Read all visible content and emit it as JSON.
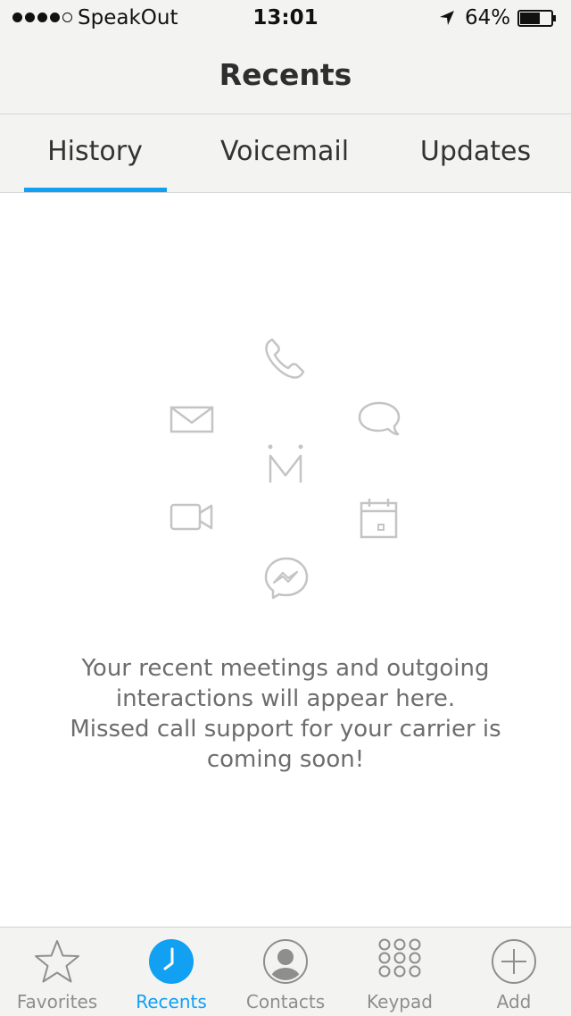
{
  "status_bar": {
    "carrier": "SpeakOut",
    "time": "13:01",
    "battery_percent": "64%",
    "signal_strength": 4,
    "signal_max": 5,
    "battery_level": 0.64
  },
  "header": {
    "title": "Recents"
  },
  "tabs": [
    {
      "label": "History",
      "active": true
    },
    {
      "label": "Voicemail",
      "active": false
    },
    {
      "label": "Updates",
      "active": false
    }
  ],
  "empty_state": {
    "icons": [
      "phone-icon",
      "email-icon",
      "chat-bubble-icon",
      "app-logo-m-icon",
      "video-icon",
      "calendar-icon",
      "messenger-icon"
    ],
    "message_lines": [
      "Your recent meetings and outgoing",
      "interactions will appear here.",
      "Missed call support for your carrier is",
      "coming soon!"
    ]
  },
  "bottom_nav": {
    "items": [
      {
        "label": "Favorites",
        "icon": "star-icon",
        "active": false
      },
      {
        "label": "Recents",
        "icon": "clock-icon",
        "active": true
      },
      {
        "label": "Contacts",
        "icon": "person-icon",
        "active": false
      },
      {
        "label": "Keypad",
        "icon": "keypad-icon",
        "active": false
      },
      {
        "label": "Add",
        "icon": "plus-circle-icon",
        "active": false
      }
    ]
  },
  "colors": {
    "accent": "#11a0f2",
    "bar_background": "#f3f3f2",
    "illustration_gray": "#c4c4c4",
    "inactive_label": "#8e8e8e"
  }
}
